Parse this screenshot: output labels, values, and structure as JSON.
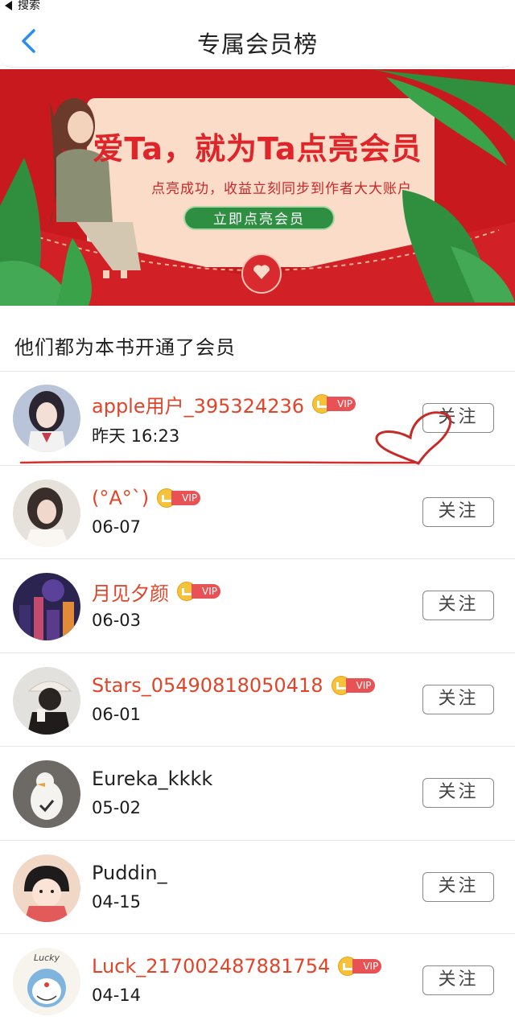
{
  "status_bar": {
    "back_label": "搜索"
  },
  "navbar": {
    "title": "专属会员榜"
  },
  "banner": {
    "headline": "爱Ta，就为Ta点亮会员",
    "subtitle": "点亮成功，收益立刻同步到作者大大账户",
    "cta_label": "立即点亮会员",
    "colors": {
      "background": "#c8191f",
      "card": "#fbdcc8",
      "cta": "#2e8f43",
      "leaf": "#2f8f3e"
    }
  },
  "section_title": "他们都为本书开通了会员",
  "vip_label": "VIP",
  "members": [
    {
      "name": "apple用户_395324236",
      "time": "昨天 16:23",
      "vip": true,
      "follow_label": "关注",
      "avatar": "anime-girl-avatar"
    },
    {
      "name": "(°A°`)",
      "time": "06-07",
      "vip": true,
      "follow_label": "关注",
      "avatar": "girl-photo-avatar"
    },
    {
      "name": "月见夕颜",
      "time": "06-03",
      "vip": true,
      "follow_label": "关注",
      "avatar": "city-night-avatar"
    },
    {
      "name": "Stars_05490818050418",
      "time": "06-01",
      "vip": true,
      "follow_label": "关注",
      "avatar": "coffee-girl-avatar"
    },
    {
      "name": "Eureka_kkkk",
      "time": "05-02",
      "vip": false,
      "follow_label": "关注",
      "avatar": "duck-avatar"
    },
    {
      "name": "Puddin_",
      "time": "04-15",
      "vip": false,
      "follow_label": "关注",
      "avatar": "cartoon-kid-avatar"
    },
    {
      "name": "Luck_21700248788175​4",
      "time": "04-14",
      "vip": true,
      "follow_label": "关注",
      "avatar": "doraemon-avatar",
      "avatar_text": "Lucky"
    }
  ],
  "colors": {
    "vip_name": "#e0452a",
    "plain_name": "#222222",
    "vip_badge": "#e85255",
    "crown": "#f6c23a",
    "accent_blue": "#2a8cf0"
  }
}
